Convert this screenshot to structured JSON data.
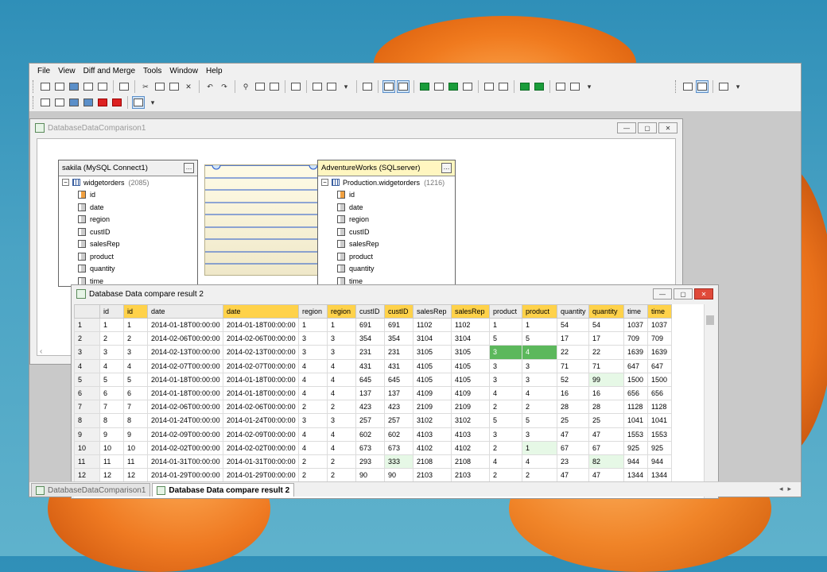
{
  "menu": [
    "File",
    "View",
    "Diff and Merge",
    "Tools",
    "Window",
    "Help"
  ],
  "compare_window": {
    "title": "DatabaseDataComparison1",
    "left_table": {
      "header": "sakila (MySQL Connect1)",
      "table_name": "widgetorders",
      "row_count": "(2085)",
      "columns": [
        "id",
        "date",
        "region",
        "custID",
        "salesRep",
        "product",
        "quantity",
        "time"
      ]
    },
    "right_table": {
      "header": "AdventureWorks (SQLserver)",
      "table_name": "Production.widgetorders",
      "row_count": "(1216)",
      "columns": [
        "id",
        "date",
        "region",
        "custID",
        "salesRep",
        "product",
        "quantity",
        "time"
      ]
    }
  },
  "result_window": {
    "title": "Database Data compare result 2",
    "headers": [
      "",
      "id",
      "id",
      "date",
      "date",
      "region",
      "region",
      "custID",
      "custID",
      "salesRep",
      "salesRep",
      "product",
      "product",
      "quantity",
      "quantity",
      "time",
      "time"
    ],
    "rows": [
      [
        "1",
        "1",
        "1",
        "2014-01-18T00:00:00",
        "2014-01-18T00:00:00",
        "1",
        "1",
        "691",
        "691",
        "1102",
        "1102",
        "1",
        "1",
        "54",
        "54",
        "1037",
        "1037"
      ],
      [
        "2",
        "2",
        "2",
        "2014-02-06T00:00:00",
        "2014-02-06T00:00:00",
        "3",
        "3",
        "354",
        "354",
        "3104",
        "3104",
        "5",
        "5",
        "17",
        "17",
        "709",
        "709"
      ],
      [
        "3",
        "3",
        "3",
        "2014-02-13T00:00:00",
        "2014-02-13T00:00:00",
        "3",
        "3",
        "231",
        "231",
        "3105",
        "3105",
        "3",
        "4",
        "22",
        "22",
        "1639",
        "1639"
      ],
      [
        "4",
        "4",
        "4",
        "2014-02-07T00:00:00",
        "2014-02-07T00:00:00",
        "4",
        "4",
        "431",
        "431",
        "4105",
        "4105",
        "3",
        "3",
        "71",
        "71",
        "647",
        "647"
      ],
      [
        "5",
        "5",
        "5",
        "2014-01-18T00:00:00",
        "2014-01-18T00:00:00",
        "4",
        "4",
        "645",
        "645",
        "4105",
        "4105",
        "3",
        "3",
        "52",
        "99",
        "1500",
        "1500"
      ],
      [
        "6",
        "6",
        "6",
        "2014-01-18T00:00:00",
        "2014-01-18T00:00:00",
        "4",
        "4",
        "137",
        "137",
        "4109",
        "4109",
        "4",
        "4",
        "16",
        "16",
        "656",
        "656"
      ],
      [
        "7",
        "7",
        "7",
        "2014-02-06T00:00:00",
        "2014-02-06T00:00:00",
        "2",
        "2",
        "423",
        "423",
        "2109",
        "2109",
        "2",
        "2",
        "28",
        "28",
        "1128",
        "1128"
      ],
      [
        "8",
        "8",
        "8",
        "2014-01-24T00:00:00",
        "2014-01-24T00:00:00",
        "3",
        "3",
        "257",
        "257",
        "3102",
        "3102",
        "5",
        "5",
        "25",
        "25",
        "1041",
        "1041"
      ],
      [
        "9",
        "9",
        "9",
        "2014-02-09T00:00:00",
        "2014-02-09T00:00:00",
        "4",
        "4",
        "602",
        "602",
        "4103",
        "4103",
        "3",
        "3",
        "47",
        "47",
        "1553",
        "1553"
      ],
      [
        "10",
        "10",
        "10",
        "2014-02-02T00:00:00",
        "2014-02-02T00:00:00",
        "4",
        "4",
        "673",
        "673",
        "4102",
        "4102",
        "2",
        "1",
        "67",
        "67",
        "925",
        "925"
      ],
      [
        "11",
        "11",
        "11",
        "2014-01-31T00:00:00",
        "2014-01-31T00:00:00",
        "2",
        "2",
        "293",
        "333",
        "2108",
        "2108",
        "4",
        "4",
        "23",
        "82",
        "944",
        "944"
      ],
      [
        "12",
        "12",
        "12",
        "2014-01-29T00:00:00",
        "2014-01-29T00:00:00",
        "2",
        "2",
        "90",
        "90",
        "2103",
        "2103",
        "2",
        "2",
        "47",
        "47",
        "1344",
        "1344"
      ]
    ],
    "diffs_light": [
      [
        2,
        12
      ],
      [
        4,
        14
      ],
      [
        9,
        12
      ],
      [
        10,
        8
      ],
      [
        10,
        14
      ]
    ],
    "diffs_dark": [
      [
        2,
        11
      ],
      [
        2,
        12
      ]
    ]
  },
  "tabs": [
    "DatabaseDataComparison1",
    "Database Data compare result 2"
  ]
}
